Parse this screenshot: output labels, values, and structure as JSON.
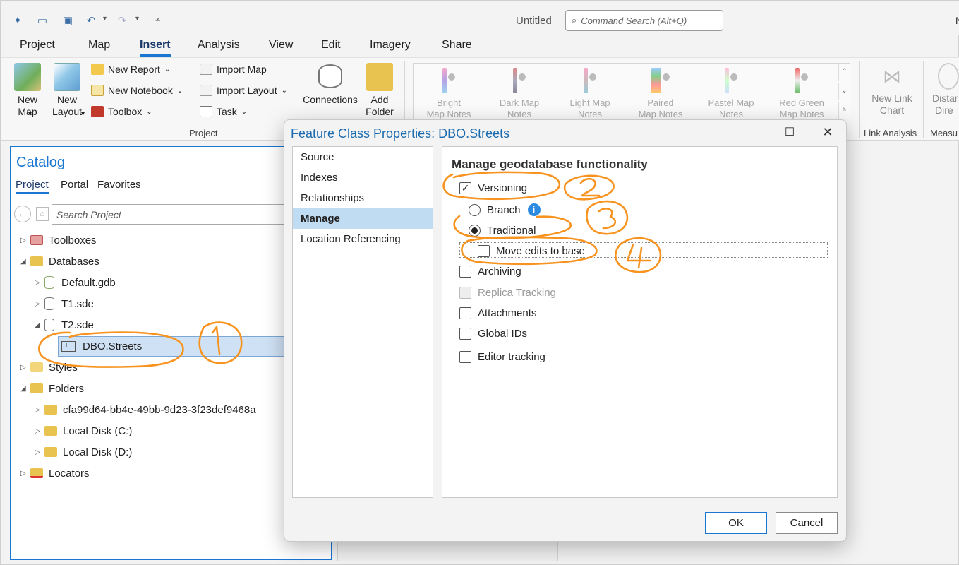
{
  "window": {
    "title": "Untitled",
    "command_search_placeholder": "Command Search (Alt+Q)"
  },
  "ribbon_tabs": [
    "Project",
    "Map",
    "Insert",
    "Analysis",
    "View",
    "Edit",
    "Imagery",
    "Share"
  ],
  "active_tab": "Insert",
  "ribbon": {
    "new_map": "New Map",
    "new_layout": "New Layout",
    "new_report": "New Report",
    "new_notebook": "New Notebook",
    "toolbox": "Toolbox",
    "import_map": "Import Map",
    "import_layout": "Import Layout",
    "task": "Task",
    "connections": "Connections",
    "add_folder": "Add Folder",
    "project_group": "Project",
    "gallery": [
      {
        "line1": "Bright",
        "line2": "Map Notes"
      },
      {
        "line1": "Dark Map",
        "line2": "Notes"
      },
      {
        "line1": "Light Map",
        "line2": "Notes"
      },
      {
        "line1": "Paired",
        "line2": "Map Notes"
      },
      {
        "line1": "Pastel Map",
        "line2": "Notes"
      },
      {
        "line1": "Red Green",
        "line2": "Map Notes"
      }
    ],
    "new_link_chart": "New Link Chart",
    "link_analysis_group": "Link Analysis",
    "distance_line1": "Distar",
    "distance_line2": "Dire",
    "measure_group": "Measu"
  },
  "catalog": {
    "title": "Catalog",
    "tabs": [
      "Project",
      "Portal",
      "Favorites"
    ],
    "search_placeholder": "Search Project",
    "tree": {
      "toolboxes": "Toolboxes",
      "databases": "Databases",
      "default_gdb": "Default.gdb",
      "t1": "T1.sde",
      "t2": "T2.sde",
      "streets": "DBO.Streets",
      "styles": "Styles",
      "folders": "Folders",
      "guid_folder": "cfa99d64-bb4e-49bb-9d23-3f23def9468a",
      "disk_c": "Local Disk (C:)",
      "disk_d": "Local Disk (D:)",
      "locators": "Locators"
    }
  },
  "dialog": {
    "title": "Feature Class Properties: DBO.Streets",
    "nav": [
      "Source",
      "Indexes",
      "Relationships",
      "Manage",
      "Location Referencing"
    ],
    "selected_nav": "Manage",
    "heading": "Manage geodatabase functionality",
    "options": {
      "versioning": {
        "label": "Versioning",
        "checked": true
      },
      "branch": {
        "label": "Branch",
        "selected": false
      },
      "traditional": {
        "label": "Traditional",
        "selected": true
      },
      "move_edits": {
        "label": "Move edits to base",
        "checked": false
      },
      "archiving": {
        "label": "Archiving",
        "checked": false
      },
      "replica": {
        "label": "Replica Tracking",
        "checked": false,
        "disabled": true
      },
      "attachments": {
        "label": "Attachments",
        "checked": false
      },
      "global_ids": {
        "label": "Global IDs",
        "checked": false
      },
      "editor_tracking": {
        "label": "Editor tracking",
        "checked": false
      }
    },
    "ok": "OK",
    "cancel": "Cancel"
  },
  "colors": {
    "accent": "#1976d2",
    "annotation": "#f7931e",
    "selection": "#bfdcf3"
  }
}
